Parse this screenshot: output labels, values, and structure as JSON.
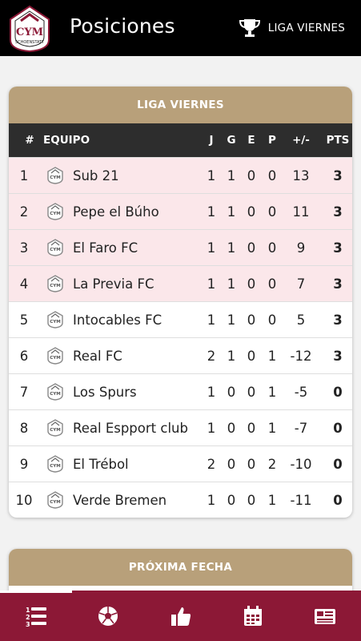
{
  "header": {
    "title": "Posiciones",
    "league_button": "LIGA VIERNES",
    "logo_text": "CYM SCHOENSTATT"
  },
  "standings": {
    "title": "LIGA VIERNES",
    "columns": {
      "pos": "#",
      "team": "EQUIPO",
      "j": "J",
      "g": "G",
      "e": "E",
      "p": "P",
      "dif": "+/-",
      "pts": "PTS"
    },
    "rows": [
      {
        "pos": "1",
        "team": "Sub 21",
        "j": "1",
        "g": "1",
        "e": "0",
        "p": "0",
        "dif": "13",
        "pts": "3",
        "highlight": true
      },
      {
        "pos": "2",
        "team": "Pepe el Búho",
        "j": "1",
        "g": "1",
        "e": "0",
        "p": "0",
        "dif": "11",
        "pts": "3",
        "highlight": true
      },
      {
        "pos": "3",
        "team": "El Faro FC",
        "j": "1",
        "g": "1",
        "e": "0",
        "p": "0",
        "dif": "9",
        "pts": "3",
        "highlight": true
      },
      {
        "pos": "4",
        "team": "La Previa FC",
        "j": "1",
        "g": "1",
        "e": "0",
        "p": "0",
        "dif": "7",
        "pts": "3",
        "highlight": true
      },
      {
        "pos": "5",
        "team": "Intocables FC",
        "j": "1",
        "g": "1",
        "e": "0",
        "p": "0",
        "dif": "5",
        "pts": "3",
        "highlight": false
      },
      {
        "pos": "6",
        "team": "Real FC",
        "j": "2",
        "g": "1",
        "e": "0",
        "p": "1",
        "dif": "-12",
        "pts": "3",
        "highlight": false
      },
      {
        "pos": "7",
        "team": "Los Spurs",
        "j": "1",
        "g": "0",
        "e": "0",
        "p": "1",
        "dif": "-5",
        "pts": "0",
        "highlight": false
      },
      {
        "pos": "8",
        "team": "Real Espport club",
        "j": "1",
        "g": "0",
        "e": "0",
        "p": "1",
        "dif": "-7",
        "pts": "0",
        "highlight": false
      },
      {
        "pos": "9",
        "team": "El Trébol",
        "j": "2",
        "g": "0",
        "e": "0",
        "p": "2",
        "dif": "-10",
        "pts": "0",
        "highlight": false
      },
      {
        "pos": "10",
        "team": "Verde Bremen",
        "j": "1",
        "g": "0",
        "e": "0",
        "p": "1",
        "dif": "-11",
        "pts": "0",
        "highlight": false
      }
    ]
  },
  "next_round": {
    "title": "PRÓXIMA FECHA"
  },
  "bottom_nav": {
    "items": [
      {
        "icon": "standings-list-icon",
        "active": true
      },
      {
        "icon": "soccer-ball-icon",
        "active": false
      },
      {
        "icon": "thumbs-up-icon",
        "active": false
      },
      {
        "icon": "calendar-icon",
        "active": false
      },
      {
        "icon": "news-icon",
        "active": false
      }
    ]
  },
  "colors": {
    "accent": "#8c1836",
    "card_header": "#b8a07a",
    "table_header": "#2d2d2d",
    "highlight_row": "#fbe7ea"
  }
}
